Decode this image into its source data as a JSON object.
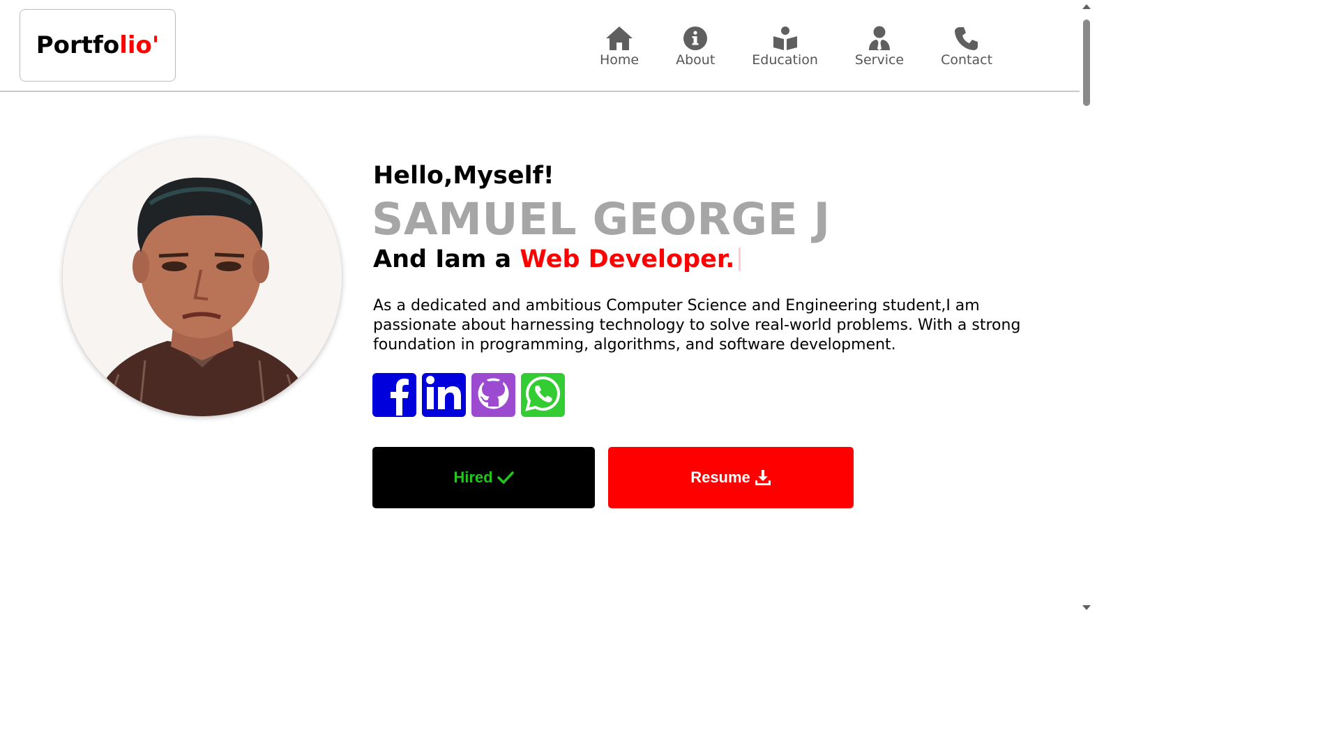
{
  "logo": {
    "text_black": "Portfo",
    "text_red": "lio'",
    "accent_color": "#ff0000"
  },
  "nav": {
    "items": [
      {
        "label": "Home",
        "icon": "home-icon"
      },
      {
        "label": "About",
        "icon": "info-icon"
      },
      {
        "label": "Education",
        "icon": "book-reader-icon"
      },
      {
        "label": "Service",
        "icon": "user-tie-icon"
      },
      {
        "label": "Contact",
        "icon": "phone-icon"
      }
    ]
  },
  "hero": {
    "greeting": "Hello,Myself!",
    "name": "SAMUEL GEORGE J",
    "role_prefix": "And Iam a ",
    "role_highlight": "Web Developer.",
    "bio": "As a dedicated and ambitious Computer Science and Engineering student,I am passionate about harnessing technology to solve real-world problems. With a strong foundation in programming, algorithms, and software development.",
    "photo": "profile-photo"
  },
  "socials": [
    {
      "name": "facebook",
      "icon": "facebook-icon",
      "color": "#0000dd"
    },
    {
      "name": "linkedin",
      "icon": "linkedin-icon",
      "color": "#0000dd"
    },
    {
      "name": "github",
      "icon": "github-icon",
      "color": "#9c4ad0"
    },
    {
      "name": "whatsapp",
      "icon": "whatsapp-icon",
      "color": "#33cc33"
    }
  ],
  "buttons": {
    "hired_label": "Hired",
    "hired_icon": "check-icon",
    "resume_label": "Resume",
    "resume_icon": "download-icon"
  },
  "colors": {
    "name_gray": "#a6a6a6",
    "hired_green": "#22c51d",
    "resume_red": "#ff0000"
  }
}
